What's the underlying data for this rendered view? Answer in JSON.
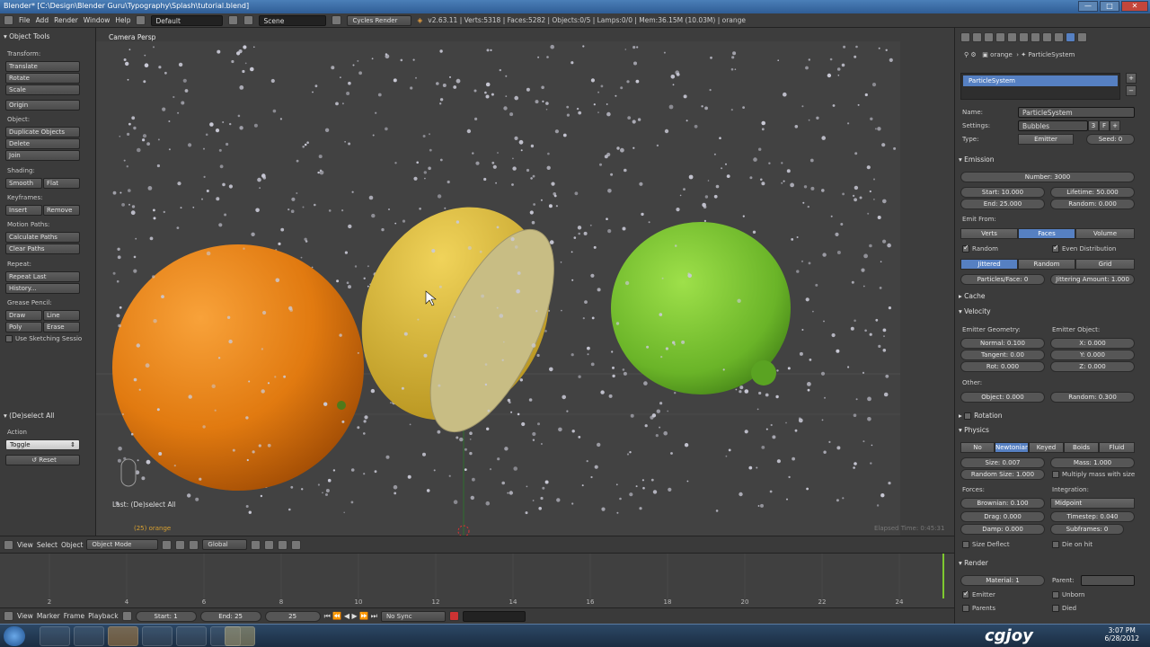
{
  "window": {
    "title": "Blender* [C:\\Design\\Blender Guru\\Typography\\Splash\\tutorial.blend]",
    "minimize": "—",
    "maximize": "□",
    "close": "✕"
  },
  "infobar": {
    "menus": [
      "File",
      "Add",
      "Render",
      "Window",
      "Help"
    ],
    "layout": "Default",
    "scene": "Scene",
    "engine": "Cycles Render",
    "stats": "v2.63.11 | Verts:5318 | Faces:5282 | Objects:0/5 | Lamps:0/0 | Mem:36.15M (10.03M) | orange"
  },
  "toolshelf": {
    "title": "Object Tools",
    "transform_label": "Transform:",
    "translate": "Translate",
    "rotate": "Rotate",
    "scale": "Scale",
    "origin": "Origin",
    "object_label": "Object:",
    "duplicate": "Duplicate Objects",
    "delete": "Delete",
    "join": "Join",
    "shading_label": "Shading:",
    "smooth": "Smooth",
    "flat": "Flat",
    "keyframes_label": "Keyframes:",
    "insert": "Insert",
    "remove": "Remove",
    "motion_label": "Motion Paths:",
    "calc_paths": "Calculate Paths",
    "clear_paths": "Clear Paths",
    "repeat_label": "Repeat:",
    "repeat_last": "Repeat Last",
    "history": "History...",
    "grease_label": "Grease Pencil:",
    "draw": "Draw",
    "line": "Line",
    "poly": "Poly",
    "erase": "Erase",
    "sketching": "Use Sketching Sessio",
    "op_title": "(De)select All",
    "action_label": "Action",
    "action_value": "Toggle",
    "reset": "Reset"
  },
  "viewport": {
    "label": "Camera Persp",
    "last_op": "Last: (De)select All",
    "frame_obj": "(25) orange",
    "elapsed": "Elapsed Time: 0:45:31"
  },
  "view3d_header": {
    "view": "View",
    "select": "Select",
    "object": "Object",
    "mode": "Object Mode",
    "orientation": "Global"
  },
  "timeline": {
    "ticks": [
      "2",
      "4",
      "6",
      "8",
      "10",
      "12",
      "14",
      "16",
      "18",
      "20",
      "22",
      "24"
    ]
  },
  "timeline_header": {
    "view": "View",
    "marker": "Marker",
    "frame": "Frame",
    "playback": "Playback",
    "start": "Start: 1",
    "end": "End: 25",
    "current": "25",
    "sync": "No Sync"
  },
  "props": {
    "crumb_obj": "orange",
    "crumb_ps": "ParticleSystem",
    "list_item": "ParticleSystem",
    "name_label": "Name:",
    "name_value": "ParticleSystem",
    "settings_label": "Settings:",
    "settings_value": "Bubbles",
    "settings_users": "3",
    "settings_f": "F",
    "type_label": "Type:",
    "type_value": "Emitter",
    "seed": "Seed: 0",
    "emission": "Emission",
    "number": "Number: 3000",
    "start": "Start: 10.000",
    "lifetime": "Lifetime: 50.000",
    "end": "End: 25.000",
    "random": "Random: 0.000",
    "emit_from": "Emit From:",
    "verts": "Verts",
    "faces": "Faces",
    "volume": "Volume",
    "random_cb": "Random",
    "even_dist": "Even Distribution",
    "jittered": "Jittered",
    "random2": "Random",
    "grid": "Grid",
    "ppf": "Particles/Face: 0",
    "jitter_amount": "Jittering Amount: 1.000",
    "cache": "Cache",
    "velocity": "Velocity",
    "emitter_geom": "Emitter Geometry:",
    "emitter_obj": "Emitter Object:",
    "normal": "Normal: 0.100",
    "vx": "X: 0.000",
    "tangent": "Tangent: 0.00",
    "vy": "Y: 0.000",
    "rot": "Rot: 0.000",
    "vz": "Z: 0.000",
    "other": "Other:",
    "object": "Object: 0.000",
    "vrandom": "Random: 0.300",
    "rotation": "Rotation",
    "physics": "Physics",
    "no": "No",
    "newtonian": "Newtonian",
    "keyed": "Keyed",
    "boids": "Boids",
    "fluid": "Fluid",
    "size": "Size: 0.007",
    "mass": "Mass: 1.000",
    "random_size": "Random Size: 1.000",
    "multiply_mass": "Multiply mass with size",
    "forces": "Forces:",
    "integration": "Integration:",
    "brownian": "Brownian: 0.100",
    "integ_value": "Midpoint",
    "drag": "Drag: 0.000",
    "timestep": "Timestep: 0.040",
    "damp": "Damp: 0.000",
    "subframes": "Subframes: 0",
    "size_deflect": "Size Deflect",
    "die_on_hit": "Die on hit",
    "render": "Render",
    "material": "Material: 1",
    "parent": "Parent:",
    "emitter": "Emitter",
    "unborn": "Unborn",
    "parents": "Parents",
    "died": "Died"
  },
  "taskbar": {
    "time": "3:07 PM",
    "date": "6/28/2012",
    "watermark": "cgjoy"
  },
  "colors": {
    "accent": "#5680c2",
    "orange": "#e87e10",
    "lemon": "#e2c23c",
    "lime": "#7ec830"
  }
}
